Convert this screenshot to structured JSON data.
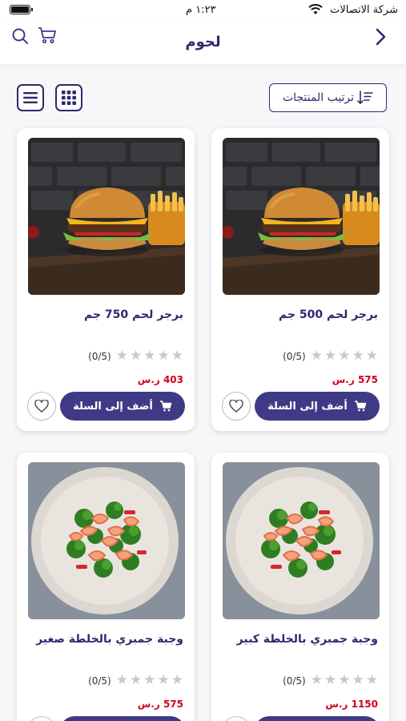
{
  "status_bar": {
    "carrier": "شركة الاتصالات",
    "time": "١:٢٣ م"
  },
  "header": {
    "title": "لحوم"
  },
  "toolbar": {
    "sort_label": "ترتيب المنتجات"
  },
  "products": [
    {
      "name": "برجر لحم 500 جم",
      "rating": "(0/5)",
      "price": "575 ر.س",
      "add_label": "أضف إلى السلة",
      "image": "burger"
    },
    {
      "name": "برجر لحم 750 جم",
      "rating": "(0/5)",
      "price": "403 ر.س",
      "add_label": "أضف إلى السلة",
      "image": "burger"
    },
    {
      "name": "وجبة جمبري بالخلطة كبير",
      "rating": "(0/5)",
      "price": "1150 ر.س",
      "add_label": "أضف إلى السلة",
      "image": "shrimp"
    },
    {
      "name": "وجبة جمبري بالخلطة صغير",
      "rating": "(0/5)",
      "price": "575 ر.س",
      "add_label": "أضف إلى السلة",
      "image": "shrimp"
    }
  ],
  "colors": {
    "primary": "#3f3a86",
    "title": "#2d2a6e",
    "price": "#d0021b",
    "star": "#c8c8cc"
  },
  "icons": [
    "battery-icon",
    "wifi-icon",
    "back-chevron-icon",
    "search-icon",
    "cart-icon",
    "sort-icon",
    "list-view-icon",
    "grid-view-icon",
    "star-icon",
    "cart-add-icon",
    "heart-icon"
  ]
}
